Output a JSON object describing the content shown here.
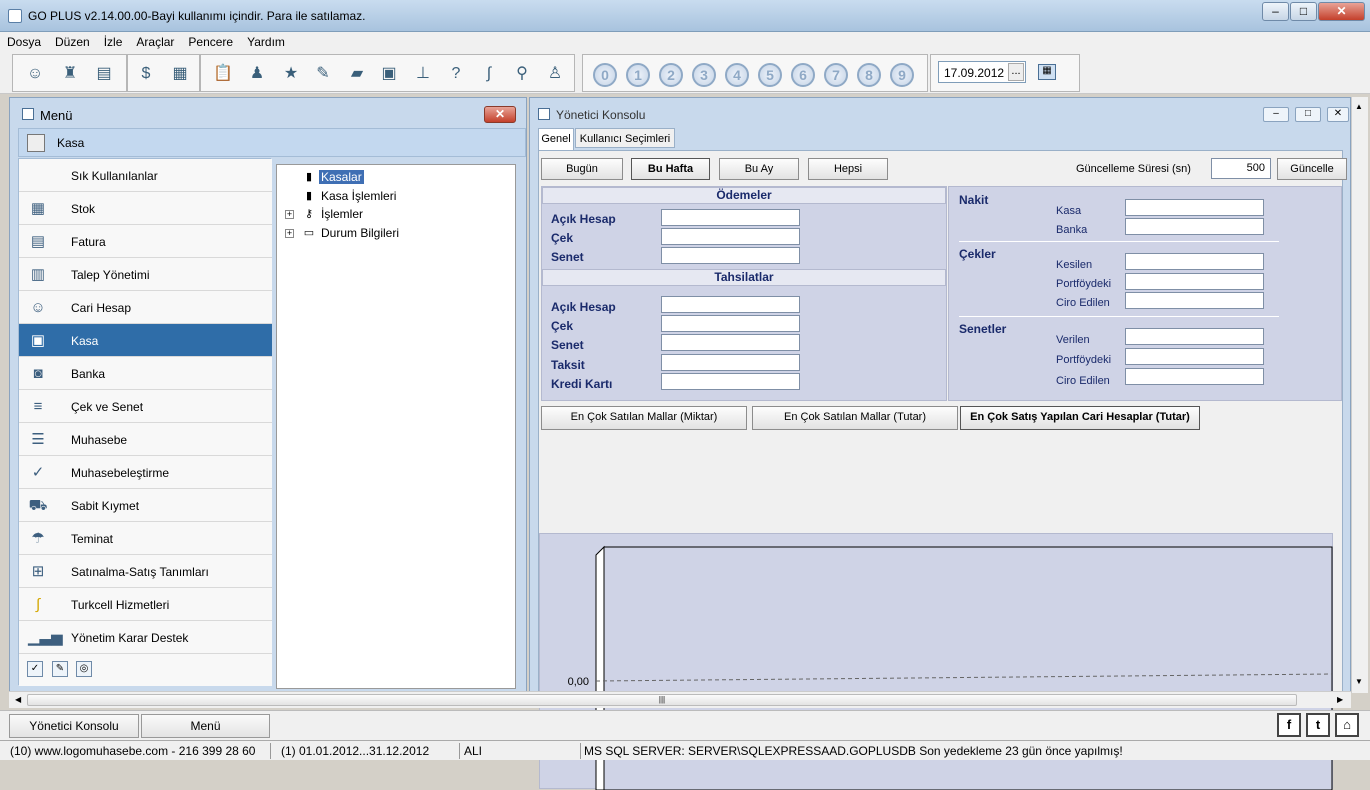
{
  "window": {
    "title": "GO PLUS v2.14.00.00-Bayi kullanımı içindir. Para ile satılamaz."
  },
  "menubar": [
    "Dosya",
    "Düzen",
    "İzle",
    "Araçlar",
    "Pencere",
    "Yardım"
  ],
  "toolbar": {
    "date_value": "17.09.2012",
    "date_button": "...",
    "number_buttons": [
      "0",
      "1",
      "2",
      "3",
      "4",
      "5",
      "6",
      "7",
      "8",
      "9"
    ]
  },
  "menu_window": {
    "title": "Menü",
    "close_label": "✕",
    "header_label": "Kasa",
    "nav_items": [
      {
        "label": "Sık Kullanılanlar",
        "icon": "star-icon"
      },
      {
        "label": "Stok",
        "icon": "boxes-icon"
      },
      {
        "label": "Fatura",
        "icon": "invoice-icon"
      },
      {
        "label": "Talep Yönetimi",
        "icon": "request-icon"
      },
      {
        "label": "Cari Hesap",
        "icon": "contact-card-icon"
      },
      {
        "label": "Kasa",
        "icon": "safe-icon"
      },
      {
        "label": "Banka",
        "icon": "bank-icon"
      },
      {
        "label": "Çek ve Senet",
        "icon": "cheque-icon"
      },
      {
        "label": "Muhasebe",
        "icon": "ledger-icon"
      },
      {
        "label": "Muhasebeleştirme",
        "icon": "check-document-icon"
      },
      {
        "label": "Sabit Kıymet",
        "icon": "car-icon"
      },
      {
        "label": "Teminat",
        "icon": "umbrella-icon"
      },
      {
        "label": "Satınalma-Satış Tanımları",
        "icon": "cart-icon"
      },
      {
        "label": "Turkcell Hizmetleri",
        "icon": "turkcell-icon"
      },
      {
        "label": "Yönetim Karar Destek",
        "icon": "bar-chart-icon"
      }
    ],
    "tree": [
      {
        "label": "Kasalar",
        "expand": ""
      },
      {
        "label": "Kasa İşlemleri",
        "expand": ""
      },
      {
        "label": "İşlemler",
        "expand": "+"
      },
      {
        "label": "Durum Bilgileri",
        "expand": "+"
      }
    ]
  },
  "console": {
    "title": "Yönetici Konsolu",
    "tabs": [
      "Genel",
      "Kullanıcı Seçimleri"
    ],
    "period_buttons": [
      "Bugün",
      "Bu Hafta",
      "Bu Ay",
      "Hepsi"
    ],
    "refresh_label": "Güncelleme Süresi (sn)",
    "refresh_value": "500",
    "refresh_button": "Güncelle",
    "odemeler": {
      "title": "Ödemeler",
      "rows": [
        "Açık Hesap",
        "Çek",
        "Senet"
      ]
    },
    "tahsilatlar": {
      "title": "Tahsilatlar",
      "rows": [
        "Açık Hesap",
        "Çek",
        "Senet",
        "Taksit",
        "Kredi Kartı"
      ]
    },
    "nakit": {
      "title": "Nakit",
      "rows": [
        "Kasa",
        "Banka"
      ]
    },
    "cekler": {
      "title": "Çekler",
      "rows": [
        "Kesilen",
        "Portföydeki",
        "Ciro Edilen"
      ]
    },
    "senetler": {
      "title": "Senetler",
      "rows": [
        "Verilen",
        "Portföydeki",
        "Ciro Edilen"
      ]
    },
    "chart_tabs": [
      "En Çok Satılan Mallar (Miktar)",
      "En Çok Satılan Mallar (Tutar)",
      "En Çok Satış Yapılan Cari Hesaplar (Tutar)"
    ],
    "chart_tick": "0,00"
  },
  "taskbar": {
    "tasks": [
      "Yönetici Konsolu",
      "Menü"
    ],
    "icons": [
      "f",
      "t",
      "⌂"
    ]
  },
  "statusbar": {
    "phone": "(10) www.logomuhasebe.com - 216 399 28 60",
    "period": "(1) 01.01.2012...31.12.2012",
    "user": "ALI",
    "server": "MS SQL SERVER: SERVER\\SQLEXPRESSAAD.GOPLUSDB Son yedekleme 23 gün önce yapılmış!"
  }
}
